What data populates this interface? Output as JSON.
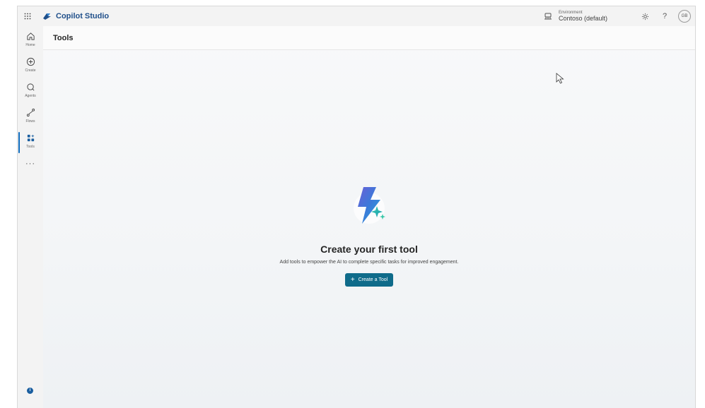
{
  "app": {
    "name": "Copilot Studio"
  },
  "environment": {
    "label": "Environment",
    "value": "Contoso (default)"
  },
  "user": {
    "initials": "GB"
  },
  "topbar": {
    "help_glyph": "?"
  },
  "rail": {
    "items": [
      {
        "label": "Home",
        "icon": "home-icon"
      },
      {
        "label": "Create",
        "icon": "plus-circle-icon"
      },
      {
        "label": "Agents",
        "icon": "agent-icon"
      },
      {
        "label": "Flows",
        "icon": "flow-icon"
      },
      {
        "label": "Tools",
        "icon": "tools-icon",
        "active": true
      }
    ],
    "more": "···"
  },
  "page": {
    "title": "Tools"
  },
  "empty_state": {
    "title": "Create your first tool",
    "subtitle": "Add tools to empower the AI to complete specific tasks for improved engagement.",
    "button_label": "Create a Tool",
    "button_color": "#0f6b8a"
  },
  "colors": {
    "accent": "#0f6cbd",
    "brand": "#1f4f8a"
  }
}
